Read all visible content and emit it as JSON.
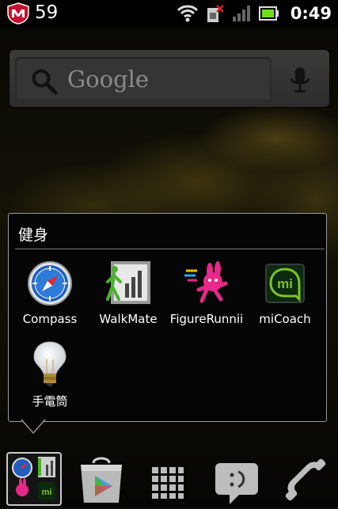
{
  "status_bar": {
    "battery_percent": "59",
    "time": "0:49",
    "icons": [
      "mcafee-shield-icon",
      "wifi-icon",
      "sim-no-signal-icon",
      "signal-bars-icon",
      "battery-icon"
    ]
  },
  "search_widget": {
    "placeholder": "Google",
    "icons": [
      "search-icon",
      "microphone-icon"
    ]
  },
  "folder": {
    "title": "健身",
    "apps": [
      {
        "label": "Compass",
        "icon": "compass-icon"
      },
      {
        "label": "WalkMate",
        "icon": "walkmate-icon"
      },
      {
        "label": "FigureRunnii",
        "icon": "figurerunning-icon"
      },
      {
        "label": "miCoach",
        "icon": "micoach-icon"
      },
      {
        "label": "手電筒",
        "icon": "lightbulb-icon"
      }
    ]
  },
  "dock": {
    "items": [
      "fitness-folder",
      "play-store-icon",
      "app-drawer-icon",
      "messaging-icon",
      "phone-icon"
    ]
  },
  "colors": {
    "micoach_green": "#7ec12a",
    "play_store_bag": "#b9b9b9",
    "status_bar": "#000000"
  }
}
